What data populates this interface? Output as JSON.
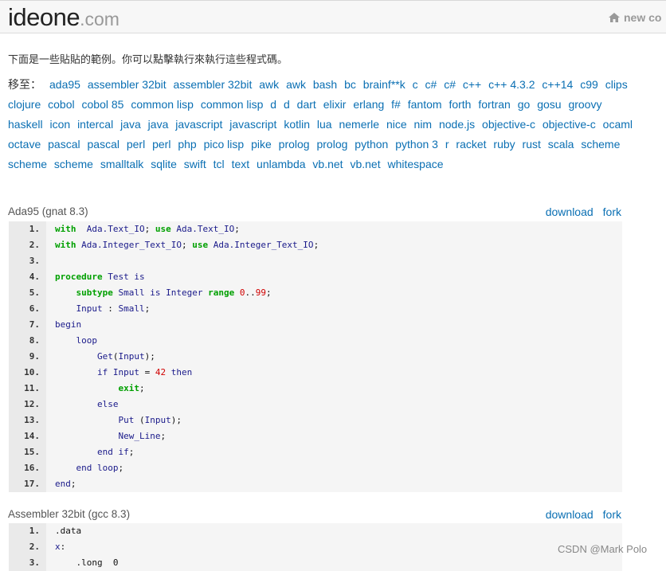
{
  "header": {
    "logo_main": "ideone",
    "logo_suffix": ".com",
    "new_code_label": "new co"
  },
  "intro": "下面是一些貼貼的範例。你可以點擊執行來執行這些程式碼。",
  "jump_label": "移至：",
  "languages": [
    "ada95",
    "assembler 32bit",
    "assembler 32bit",
    "awk",
    "awk",
    "bash",
    "bc",
    "brainf**k",
    "c",
    "c#",
    "c#",
    "c++",
    "c++ 4.3.2",
    "c++14",
    "c99",
    "clips",
    "clojure",
    "cobol",
    "cobol 85",
    "common lisp",
    "common lisp",
    "d",
    "d",
    "dart",
    "elixir",
    "erlang",
    "f#",
    "fantom",
    "forth",
    "fortran",
    "go",
    "gosu",
    "groovy",
    "haskell",
    "icon",
    "intercal",
    "java",
    "java",
    "javascript",
    "javascript",
    "kotlin",
    "lua",
    "nemerle",
    "nice",
    "nim",
    "node.js",
    "objective-c",
    "objective-c",
    "ocaml",
    "octave",
    "pascal",
    "pascal",
    "perl",
    "perl",
    "php",
    "pico lisp",
    "pike",
    "prolog",
    "prolog",
    "python",
    "python 3",
    "r",
    "racket",
    "ruby",
    "rust",
    "scala",
    "scheme",
    "scheme",
    "scheme",
    "smalltalk",
    "sqlite",
    "swift",
    "tcl",
    "text",
    "unlambda",
    "vb.net",
    "vb.net",
    "whitespace"
  ],
  "sections": [
    {
      "title": "Ada95 (gnat 8.3)",
      "download": "download",
      "fork": "fork",
      "lines": [
        {
          "n": "1.",
          "tokens": [
            [
              "kw",
              "with"
            ],
            [
              "",
              "  "
            ],
            [
              "kb",
              "Ada.Text_IO"
            ],
            [
              "",
              "; "
            ],
            [
              "kw",
              "use"
            ],
            [
              "",
              " "
            ],
            [
              "kb",
              "Ada.Text_IO"
            ],
            [
              "",
              ";"
            ]
          ]
        },
        {
          "n": "2.",
          "tokens": [
            [
              "kw",
              "with"
            ],
            [
              "",
              " "
            ],
            [
              "kb",
              "Ada.Integer_Text_IO"
            ],
            [
              "",
              "; "
            ],
            [
              "kw",
              "use"
            ],
            [
              "",
              " "
            ],
            [
              "kb",
              "Ada.Integer_Text_IO"
            ],
            [
              "",
              ";"
            ]
          ]
        },
        {
          "n": "3.",
          "tokens": []
        },
        {
          "n": "4.",
          "tokens": [
            [
              "kw",
              "procedure"
            ],
            [
              "",
              " "
            ],
            [
              "kb",
              "Test"
            ],
            [
              "",
              " "
            ],
            [
              "kb",
              "is"
            ]
          ]
        },
        {
          "n": "5.",
          "tokens": [
            [
              "",
              "    "
            ],
            [
              "kw",
              "subtype"
            ],
            [
              "",
              " "
            ],
            [
              "kb",
              "Small"
            ],
            [
              "",
              " "
            ],
            [
              "kb",
              "is"
            ],
            [
              "",
              " "
            ],
            [
              "kb",
              "Integer"
            ],
            [
              "",
              " "
            ],
            [
              "kw",
              "range"
            ],
            [
              "",
              " "
            ],
            [
              "num",
              "0"
            ],
            [
              "",
              ".."
            ],
            [
              "num",
              "99"
            ],
            [
              "",
              ";"
            ]
          ]
        },
        {
          "n": "6.",
          "tokens": [
            [
              "",
              "    "
            ],
            [
              "kb",
              "Input"
            ],
            [
              "",
              " : "
            ],
            [
              "kb",
              "Small"
            ],
            [
              "",
              ";"
            ]
          ]
        },
        {
          "n": "7.",
          "tokens": [
            [
              "kb",
              "begin"
            ]
          ]
        },
        {
          "n": "8.",
          "tokens": [
            [
              "",
              "    "
            ],
            [
              "kb",
              "loop"
            ]
          ]
        },
        {
          "n": "9.",
          "tokens": [
            [
              "",
              "        "
            ],
            [
              "kb",
              "Get"
            ],
            [
              "",
              "("
            ],
            [
              "kb",
              "Input"
            ],
            [
              "",
              ");"
            ]
          ]
        },
        {
          "n": "10.",
          "tokens": [
            [
              "",
              "        "
            ],
            [
              "kb",
              "if"
            ],
            [
              "",
              " "
            ],
            [
              "kb",
              "Input"
            ],
            [
              "",
              " = "
            ],
            [
              "num",
              "42"
            ],
            [
              "",
              " "
            ],
            [
              "kb",
              "then"
            ]
          ]
        },
        {
          "n": "11.",
          "tokens": [
            [
              "",
              "            "
            ],
            [
              "kw",
              "exit"
            ],
            [
              "",
              ";"
            ]
          ]
        },
        {
          "n": "12.",
          "tokens": [
            [
              "",
              "        "
            ],
            [
              "kb",
              "else"
            ]
          ]
        },
        {
          "n": "13.",
          "tokens": [
            [
              "",
              "            "
            ],
            [
              "kb",
              "Put"
            ],
            [
              "",
              " ("
            ],
            [
              "kb",
              "Input"
            ],
            [
              "",
              ");"
            ]
          ]
        },
        {
          "n": "14.",
          "tokens": [
            [
              "",
              "            "
            ],
            [
              "kb",
              "New_Line"
            ],
            [
              "",
              ";"
            ]
          ]
        },
        {
          "n": "15.",
          "tokens": [
            [
              "",
              "        "
            ],
            [
              "kb",
              "end"
            ],
            [
              "",
              " "
            ],
            [
              "kb",
              "if"
            ],
            [
              "",
              ";"
            ]
          ]
        },
        {
          "n": "16.",
          "tokens": [
            [
              "",
              "    "
            ],
            [
              "kb",
              "end"
            ],
            [
              "",
              " "
            ],
            [
              "kb",
              "loop"
            ],
            [
              "",
              ";"
            ]
          ]
        },
        {
          "n": "17.",
          "tokens": [
            [
              "kb",
              "end"
            ],
            [
              "",
              ";"
            ]
          ]
        }
      ]
    },
    {
      "title": "Assembler 32bit (gcc 8.3)",
      "download": "download",
      "fork": "fork",
      "lines": [
        {
          "n": "1.",
          "tokens": [
            [
              "",
              ".data"
            ]
          ]
        },
        {
          "n": "2.",
          "tokens": [
            [
              "kb",
              "x"
            ],
            [
              "",
              ":"
            ]
          ]
        },
        {
          "n": "3.",
          "tokens": [
            [
              "",
              "    .long  0"
            ]
          ]
        }
      ]
    }
  ],
  "watermark": "CSDN @Mark Polo"
}
